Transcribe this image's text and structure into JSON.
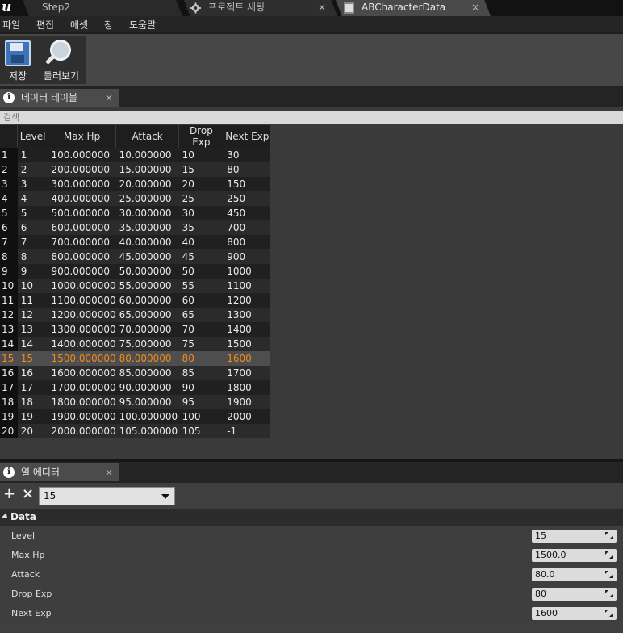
{
  "titlebar": {
    "tabs": [
      {
        "label": "Step2"
      },
      {
        "label": "프로젝트 세팅",
        "icon": "gear-icon"
      },
      {
        "label": "ABCharacterData",
        "icon": "datatable-icon"
      }
    ],
    "close_glyph": "×"
  },
  "menu": {
    "items": [
      "파일",
      "편집",
      "애셋",
      "창",
      "도움말"
    ]
  },
  "toolbar": {
    "save_label": "저장",
    "browse_label": "둘러보기"
  },
  "data_table_panel": {
    "tab_label": "데이터 테이블",
    "search_placeholder": "검색",
    "columns": [
      "Level",
      "Max Hp",
      "Attack",
      "Drop Exp",
      "Next Exp"
    ],
    "selected_row": 15,
    "rows": [
      {
        "idx": "1",
        "level": "1",
        "max_hp": "100.000000",
        "attack": "10.000000",
        "drop_exp": "10",
        "next_exp": "30"
      },
      {
        "idx": "2",
        "level": "2",
        "max_hp": "200.000000",
        "attack": "15.000000",
        "drop_exp": "15",
        "next_exp": "80"
      },
      {
        "idx": "3",
        "level": "3",
        "max_hp": "300.000000",
        "attack": "20.000000",
        "drop_exp": "20",
        "next_exp": "150"
      },
      {
        "idx": "4",
        "level": "4",
        "max_hp": "400.000000",
        "attack": "25.000000",
        "drop_exp": "25",
        "next_exp": "250"
      },
      {
        "idx": "5",
        "level": "5",
        "max_hp": "500.000000",
        "attack": "30.000000",
        "drop_exp": "30",
        "next_exp": "450"
      },
      {
        "idx": "6",
        "level": "6",
        "max_hp": "600.000000",
        "attack": "35.000000",
        "drop_exp": "35",
        "next_exp": "700"
      },
      {
        "idx": "7",
        "level": "7",
        "max_hp": "700.000000",
        "attack": "40.000000",
        "drop_exp": "40",
        "next_exp": "800"
      },
      {
        "idx": "8",
        "level": "8",
        "max_hp": "800.000000",
        "attack": "45.000000",
        "drop_exp": "45",
        "next_exp": "900"
      },
      {
        "idx": "9",
        "level": "9",
        "max_hp": "900.000000",
        "attack": "50.000000",
        "drop_exp": "50",
        "next_exp": "1000"
      },
      {
        "idx": "10",
        "level": "10",
        "max_hp": "1000.000000",
        "attack": "55.000000",
        "drop_exp": "55",
        "next_exp": "1100"
      },
      {
        "idx": "11",
        "level": "11",
        "max_hp": "1100.000000",
        "attack": "60.000000",
        "drop_exp": "60",
        "next_exp": "1200"
      },
      {
        "idx": "12",
        "level": "12",
        "max_hp": "1200.000000",
        "attack": "65.000000",
        "drop_exp": "65",
        "next_exp": "1300"
      },
      {
        "idx": "13",
        "level": "13",
        "max_hp": "1300.000000",
        "attack": "70.000000",
        "drop_exp": "70",
        "next_exp": "1400"
      },
      {
        "idx": "14",
        "level": "14",
        "max_hp": "1400.000000",
        "attack": "75.000000",
        "drop_exp": "75",
        "next_exp": "1500"
      },
      {
        "idx": "15",
        "level": "15",
        "max_hp": "1500.000000",
        "attack": "80.000000",
        "drop_exp": "80",
        "next_exp": "1600"
      },
      {
        "idx": "16",
        "level": "16",
        "max_hp": "1600.000000",
        "attack": "85.000000",
        "drop_exp": "85",
        "next_exp": "1700"
      },
      {
        "idx": "17",
        "level": "17",
        "max_hp": "1700.000000",
        "attack": "90.000000",
        "drop_exp": "90",
        "next_exp": "1800"
      },
      {
        "idx": "18",
        "level": "18",
        "max_hp": "1800.000000",
        "attack": "95.000000",
        "drop_exp": "95",
        "next_exp": "1900"
      },
      {
        "idx": "19",
        "level": "19",
        "max_hp": "1900.000000",
        "attack": "100.000000",
        "drop_exp": "100",
        "next_exp": "2000"
      },
      {
        "idx": "20",
        "level": "20",
        "max_hp": "2000.000000",
        "attack": "105.000000",
        "drop_exp": "105",
        "next_exp": "-1"
      }
    ]
  },
  "row_editor": {
    "tab_label": "열 에디터",
    "add_glyph": "+",
    "remove_glyph": "×",
    "selected_row_name": "15",
    "category": "Data",
    "properties": [
      {
        "name": "Level",
        "value": "15"
      },
      {
        "name": "Max Hp",
        "value": "1500.0"
      },
      {
        "name": "Attack",
        "value": "80.0"
      },
      {
        "name": "Drop Exp",
        "value": "80"
      },
      {
        "name": "Next Exp",
        "value": "1600"
      }
    ]
  },
  "colors": {
    "selected_row_text": "#f28a1e",
    "background": "#3a3a3a"
  }
}
